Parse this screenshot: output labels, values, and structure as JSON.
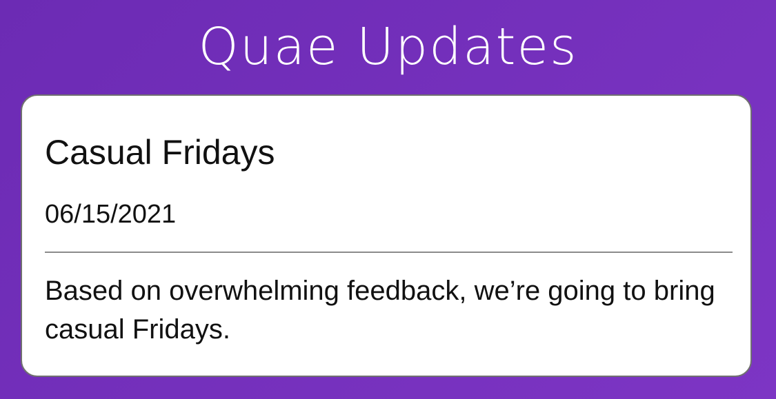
{
  "app": {
    "title": "Quae Updates"
  },
  "update": {
    "title": "Casual Fridays",
    "date": "06/15/2021",
    "body": "Based on overwhelming feedback, we’re going to bring casual Fridays."
  },
  "colors": {
    "background_start": "#6c2bb4",
    "background_end": "#7d35c4",
    "card": "#ffffff",
    "card_border": "#707070",
    "divider": "#8a8a8a",
    "text": "#111111",
    "title_text": "#ffffff"
  }
}
